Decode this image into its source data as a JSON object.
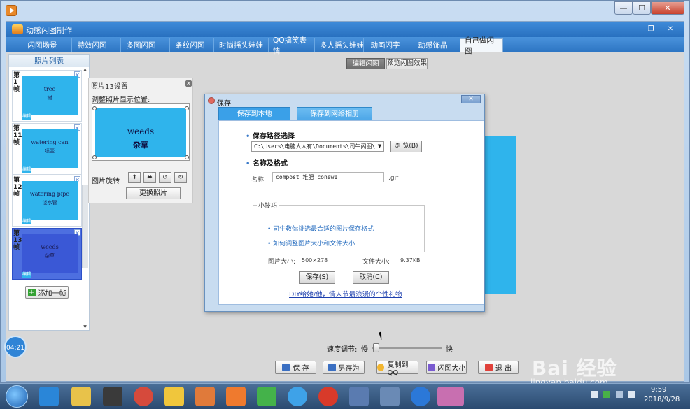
{
  "app": {
    "title": "动感闪图制作",
    "tabs": [
      "闪图场景",
      "特效闪图",
      "多图闪图",
      "条纹闪图",
      "时尚摇头娃娃",
      "QQ搞笑表情",
      "多人摇头娃娃",
      "动画闪字",
      "动感饰品",
      "自己做闪图"
    ],
    "active_tab": "自己做闪图"
  },
  "photo_list": {
    "title": "照片列表",
    "frames": [
      {
        "num": "第1帧",
        "en": "tree",
        "zh": "树"
      },
      {
        "num": "第11帧",
        "en": "watering can",
        "zh": "喷壶"
      },
      {
        "num": "第12帧",
        "en": "watering pipe",
        "zh": "浇水管"
      },
      {
        "num": "第13帧",
        "en": "weeds",
        "zh": "杂草"
      }
    ],
    "edit_label": "编辑",
    "add_label": "添加一帧"
  },
  "photo_settings": {
    "title": "照片13设置",
    "position_label": "调整照片显示位置:",
    "preview_en": "weeds",
    "preview_zh": "杂草",
    "rotate_label": "图片旋转",
    "replace_label": "更换照片"
  },
  "mode": {
    "edit": "编辑闪图",
    "preview": "预览闪图效果"
  },
  "dialog": {
    "title": "保存",
    "tab_local": "保存到本地",
    "tab_online": "保存到网络相册",
    "path_section": "保存路径选择",
    "path_value": "C:\\Users\\电脑人人有\\Documents\\司牛闪图\\",
    "browse": "浏 览(B)",
    "format_section": "名称及格式",
    "name_label": "名称:",
    "name_value": "compost 堆肥_conew1",
    "ext": ".gif",
    "tips_title": "小技巧",
    "tip1": "司牛教你挑选最合适的图片保存格式",
    "tip2": "如何调整图片大小和文件大小",
    "image_size_label": "图片大小:",
    "image_size_value": "500×278",
    "file_size_label": "文件大小:",
    "file_size_value": "9.37KB",
    "save_btn": "保存(S)",
    "cancel_btn": "取消(C)",
    "diy_link": "DIY给她/他，情人节最浪漫的个性礼物"
  },
  "speed": {
    "label": "速度调节:",
    "slow": "慢",
    "fast": "快",
    "level": 0.02
  },
  "bottom_buttons": {
    "save": "保 存",
    "save_as": "另存为",
    "copy_qq": "复制到QQ",
    "size": "闪图大小",
    "exit": "退 出"
  },
  "clock_bubble": "04:21",
  "watermark": {
    "main": "Bai 经验",
    "sub": "jingyan.baidu.com"
  },
  "taskbar": {
    "time": "9:59",
    "date": "2018/9/28"
  },
  "colors": {
    "accent": "#2f84d6",
    "frame_bg": "#2fb4ec",
    "selected_frame": "#4d6fe0"
  }
}
